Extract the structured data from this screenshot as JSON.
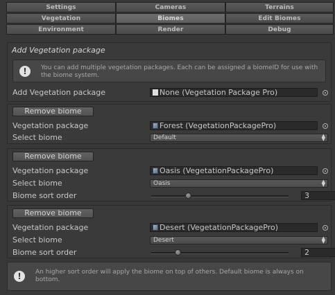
{
  "tabs": [
    [
      "Settings",
      "Cameras",
      "Terrains"
    ],
    [
      "Vegetation",
      "Biomes",
      "Edit Biomes"
    ],
    [
      "Environment",
      "Render",
      "Debug"
    ]
  ],
  "selected_tab": "Biomes",
  "header": {
    "title": "Add Vegetation package",
    "help": "You can add multiple vegetation packages. Each can be assigned a biomeID for use with the biome system.",
    "add_label": "Add Vegetation package",
    "add_value": "None (Vegetation Package Pro)"
  },
  "labels": {
    "remove": "Remove biome",
    "vegetation_package": "Vegetation package",
    "select_biome": "Select biome",
    "sort_order": "Biome sort order"
  },
  "biomes": [
    {
      "package": "Forest (VegetationPackagePro)",
      "biome": "Default"
    },
    {
      "package": "Oasis (VegetationPackagePro)",
      "biome": "Oasis",
      "sort_order": "3",
      "slider_fraction": 0.26
    },
    {
      "package": "Desert (VegetationPackagePro)",
      "biome": "Desert",
      "sort_order": "2",
      "slider_fraction": 0.18
    }
  ],
  "footer_help": "An higher sort order will apply the biome on top of others. Default biome is always on bottom.",
  "icons": {
    "help": "info-exclamation-icon",
    "picker": "object-picker-icon",
    "select_arrows": "updown-arrows-icon",
    "file": "file-icon",
    "package": "package-icon"
  },
  "colors": {
    "background": "#383838",
    "tab": "#4f4f4f",
    "tab_selected": "#656565",
    "field": "#2a2a2a",
    "help_box": "#474747"
  }
}
